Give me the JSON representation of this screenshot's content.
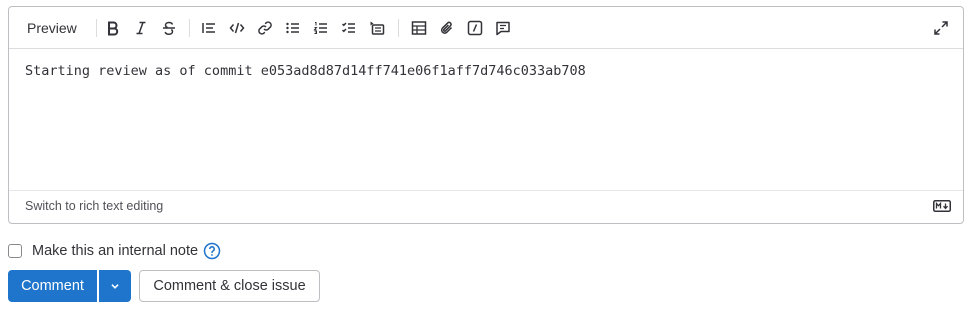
{
  "toolbar": {
    "preview_label": "Preview",
    "buttons": [
      {
        "icon": "bold-icon"
      },
      {
        "icon": "italic-icon"
      },
      {
        "icon": "strikethrough-icon"
      },
      {
        "icon": "quote-icon"
      },
      {
        "icon": "code-icon"
      },
      {
        "icon": "link-icon"
      },
      {
        "icon": "bullet-list-icon"
      },
      {
        "icon": "numbered-list-icon"
      },
      {
        "icon": "task-list-icon"
      },
      {
        "icon": "collapsible-section-icon"
      },
      {
        "icon": "table-icon"
      },
      {
        "icon": "attachment-icon"
      },
      {
        "icon": "slash-command-icon"
      },
      {
        "icon": "comment-icon"
      }
    ],
    "expand_icon": "expand-icon"
  },
  "editor": {
    "text": "Starting review as of commit e053ad8d87d14ff741e06f1aff7d746c033ab708"
  },
  "footer": {
    "switch_label": "Switch to rich text editing",
    "markdown_icon": "markdown-icon"
  },
  "internal_note": {
    "label": "Make this an internal note",
    "checked": false,
    "help_icon": "help-icon"
  },
  "actions": {
    "comment_label": "Comment",
    "close_label": "Comment & close issue"
  },
  "colors": {
    "primary": "#1f75cb",
    "text": "#333238",
    "border": "#bfbfc3"
  }
}
